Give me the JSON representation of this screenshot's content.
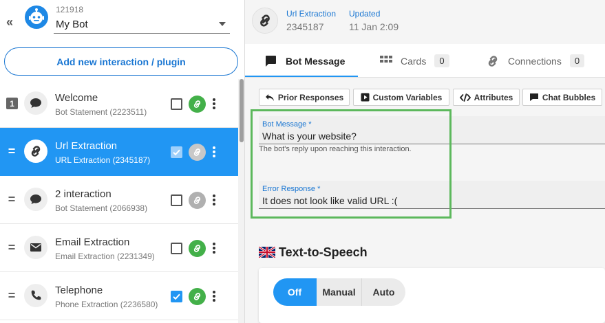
{
  "sidebar": {
    "collapse_glyph": "«",
    "bot": {
      "id": "121918",
      "name": "My Bot"
    },
    "add_button_label": "Add new interaction / plugin",
    "items": [
      {
        "handle": "1",
        "icon": "chat-bubble-icon",
        "title": "Welcome",
        "subtitle": "Bot Statement (2223511)",
        "checked": false,
        "link_status": "green",
        "selected": false
      },
      {
        "handle": "=",
        "icon": "link-icon",
        "title": "Url Extraction",
        "subtitle": "URL Extraction (2345187)",
        "checked": true,
        "link_status": "grey",
        "selected": true
      },
      {
        "handle": "=",
        "icon": "chat-bubble-icon",
        "title": "2 interaction",
        "subtitle": "Bot Statement (2066938)",
        "checked": false,
        "link_status": "grey",
        "selected": false
      },
      {
        "handle": "=",
        "icon": "envelope-icon",
        "title": "Email Extraction",
        "subtitle": "Email Extraction (2231349)",
        "checked": false,
        "link_status": "green",
        "selected": false
      },
      {
        "handle": "=",
        "icon": "phone-icon",
        "title": "Telephone",
        "subtitle": "Phone Extraction (2236580)",
        "checked": true,
        "link_status": "green",
        "selected": false
      }
    ]
  },
  "header": {
    "type_label": "Url Extraction",
    "interaction_id": "2345187",
    "updated_label": "Updated",
    "updated_value": "11 Jan 2:09"
  },
  "tabs": [
    {
      "label": "Bot Message",
      "icon": "message-icon",
      "active": true
    },
    {
      "label": "Cards",
      "icon": "grid-icon",
      "count": "0"
    },
    {
      "label": "Connections",
      "icon": "link-icon",
      "count": "0"
    }
  ],
  "toolbar": {
    "prior_responses": "Prior Responses",
    "custom_variables": "Custom Variables",
    "attributes": "Attributes",
    "chat_bubbles": "Chat Bubbles"
  },
  "form": {
    "bot_message": {
      "label": "Bot Message *",
      "value": "What is your website?",
      "helper": "The bot's reply upon reaching this interaction."
    },
    "error_response": {
      "label": "Error Response *",
      "value": "It does not look like valid URL :("
    }
  },
  "tts": {
    "title": "Text-to-Speech",
    "options": [
      "Off",
      "Manual",
      "Auto"
    ],
    "selected": "Off"
  },
  "colors": {
    "accent": "#2196f3",
    "link_active": "#43b049",
    "link_inactive": "#b0b0b0",
    "highlight": "#5cb85c"
  }
}
